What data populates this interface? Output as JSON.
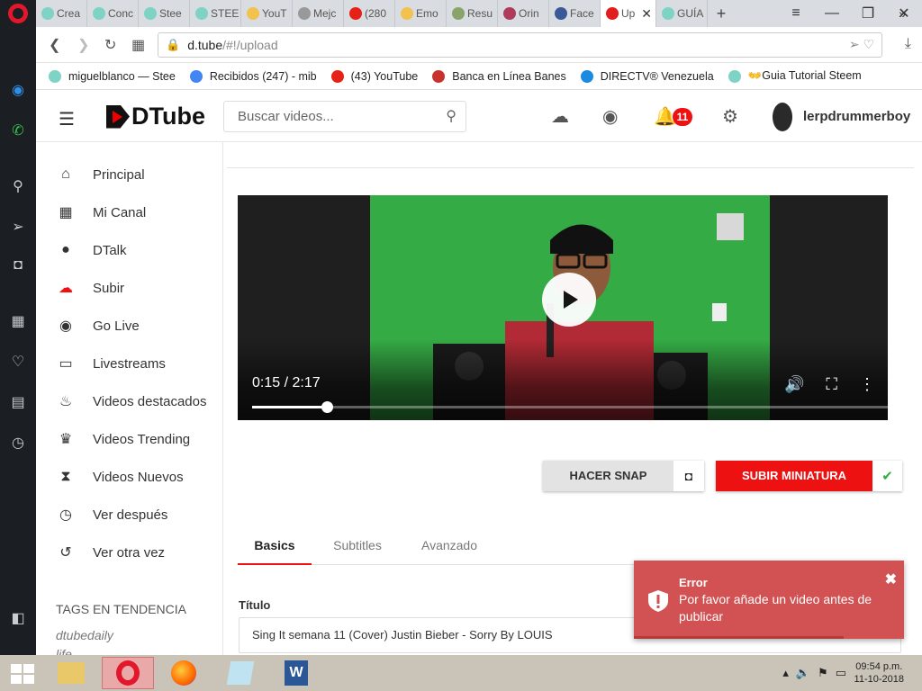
{
  "browser": {
    "tabs": [
      {
        "label": "Crea",
        "color": "#7ed3c4"
      },
      {
        "label": "Conc",
        "color": "#7ed3c4"
      },
      {
        "label": "Stee",
        "color": "#7ed3c4"
      },
      {
        "label": "STEE",
        "color": "#7ed3c4"
      },
      {
        "label": "YouT",
        "color": "#f2c14e"
      },
      {
        "label": "Mejc",
        "color": "#999999"
      },
      {
        "label": "(280",
        "color": "#e62117"
      },
      {
        "label": "Emo",
        "color": "#f2c14e"
      },
      {
        "label": "Resu",
        "color": "#8aa36b"
      },
      {
        "label": "Orin",
        "color": "#b03a5b"
      },
      {
        "label": "Face",
        "color": "#3b5998"
      },
      {
        "label": "Up",
        "color": "#e11d1d",
        "active": true
      },
      {
        "label": "GUÍA",
        "color": "#7ed3c4"
      }
    ],
    "url": {
      "domain": "d.tube",
      "path": "/#!/upload"
    },
    "bookmarks": [
      {
        "label": "miguelblanco — Stee",
        "color": "#7ed3c4"
      },
      {
        "label": "Recibidos (247) - mib",
        "color": "#4285f4"
      },
      {
        "label": "(43) YouTube",
        "color": "#e62117"
      },
      {
        "label": "Banca en Línea Banes",
        "color": "#c7322f"
      },
      {
        "label": "DIRECTV® Venezuela",
        "color": "#1a8be0"
      },
      {
        "label": "👐Guia Tutorial Steem",
        "color": "#7ed3c4"
      }
    ],
    "bookmarks_more": "»"
  },
  "header": {
    "logo": "DTube",
    "search_placeholder": "Buscar videos...",
    "notification_count": "11",
    "username": "lerpdrummerboy"
  },
  "nav": {
    "items": [
      {
        "label": "Principal",
        "icon": "home-icon",
        "glyph": "⌂"
      },
      {
        "label": "Mi Canal",
        "icon": "grid-icon",
        "glyph": "▦"
      },
      {
        "label": "DTalk",
        "icon": "chat-icon",
        "glyph": "●"
      },
      {
        "label": "Subir",
        "icon": "upload-cloud-icon",
        "glyph": "☁"
      },
      {
        "label": "Go Live",
        "icon": "podcast-icon",
        "glyph": "◉"
      },
      {
        "label": "Livestreams",
        "icon": "monitor-icon",
        "glyph": "▭"
      },
      {
        "label": "Videos destacados",
        "icon": "fire-icon",
        "glyph": "♨"
      },
      {
        "label": "Videos Trending",
        "icon": "trophy-icon",
        "glyph": "♛"
      },
      {
        "label": "Videos Nuevos",
        "icon": "hourglass-icon",
        "glyph": "⧗"
      },
      {
        "label": "Ver después",
        "icon": "clock-icon",
        "glyph": "◷"
      },
      {
        "label": "Ver otra vez",
        "icon": "history-icon",
        "glyph": "↺"
      }
    ],
    "tags_title": "TAGS EN TENDENCIA",
    "tags": [
      "dtubedaily",
      "life"
    ]
  },
  "player": {
    "time": "0:15 / 2:17",
    "progress": 0.117
  },
  "buttons": {
    "snap": "HACER SNAP",
    "upload_thumb": "SUBIR MINIATURA"
  },
  "form": {
    "tabs": [
      "Basics",
      "Subtitles",
      "Avanzado"
    ],
    "title_label": "Título",
    "title_value": "Sing It semana 11 (Cover) Justin Bieber - Sorry  By LOUIS"
  },
  "toast": {
    "title": "Error",
    "message": "Por favor añade un video antes de publicar"
  },
  "taskbar": {
    "time": "09:54 p.m.",
    "date": "11-10-2018"
  }
}
